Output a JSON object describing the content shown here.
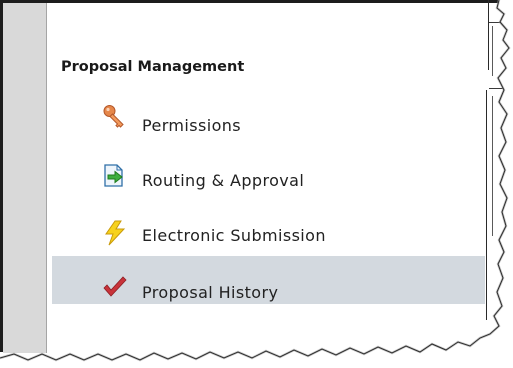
{
  "proposal_management": {
    "heading": "Proposal Management",
    "items": [
      {
        "label": "Permissions",
        "icon": "key-icon",
        "selected": false
      },
      {
        "label": "Routing & Approval",
        "icon": "routing-arrow-icon",
        "selected": false
      },
      {
        "label": "Electronic Submission",
        "icon": "lightning-icon",
        "selected": false
      },
      {
        "label": "Proposal History",
        "icon": "checkmark-icon",
        "selected": true
      }
    ]
  },
  "colors": {
    "selected_row": "#d3d9df",
    "gutter": "#d9d9d9",
    "frame": "#1d1d1d"
  }
}
